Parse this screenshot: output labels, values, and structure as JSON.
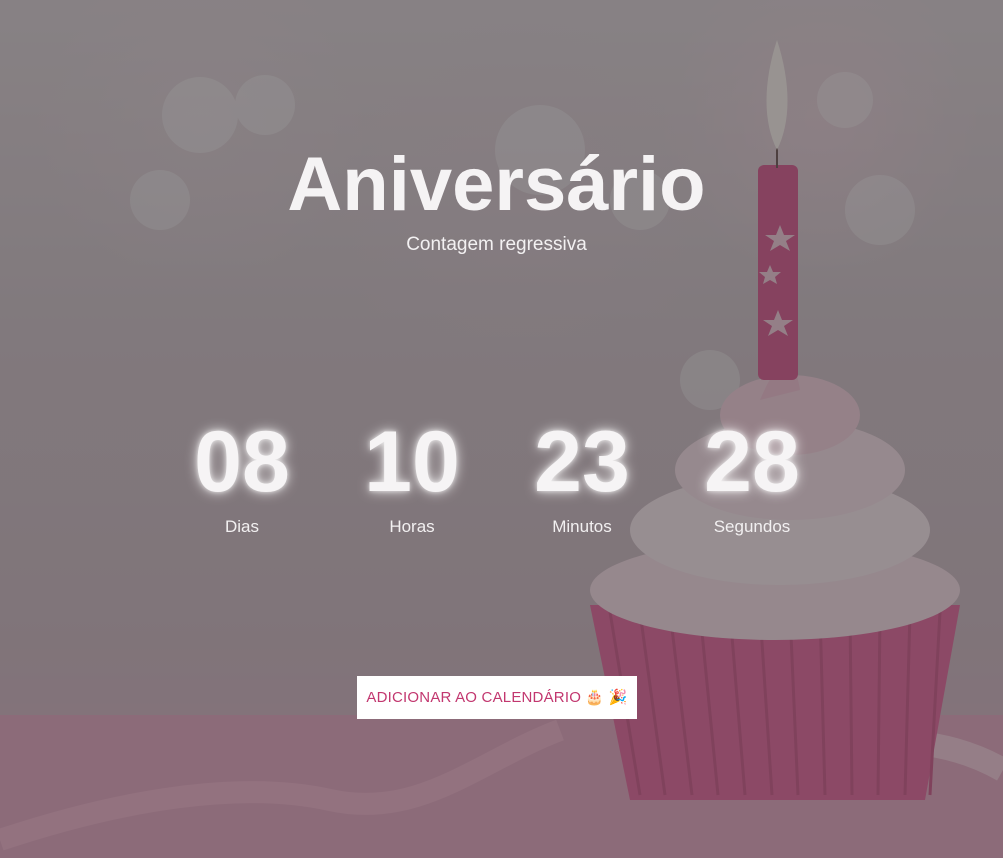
{
  "page": {
    "title": "Aniversário",
    "subtitle": "Contagem regressiva"
  },
  "countdown": [
    {
      "value": "08",
      "label": "Dias"
    },
    {
      "value": "10",
      "label": "Horas"
    },
    {
      "value": "23",
      "label": "Minutos"
    },
    {
      "value": "28",
      "label": "Segundos"
    }
  ],
  "actions": {
    "add_to_calendar_label": "ADICIONAR AO CALENDÁRIO 🎂 🎉"
  },
  "colors": {
    "overlay": "#464646",
    "accent": "#c2376f",
    "text": "#ffffff"
  }
}
